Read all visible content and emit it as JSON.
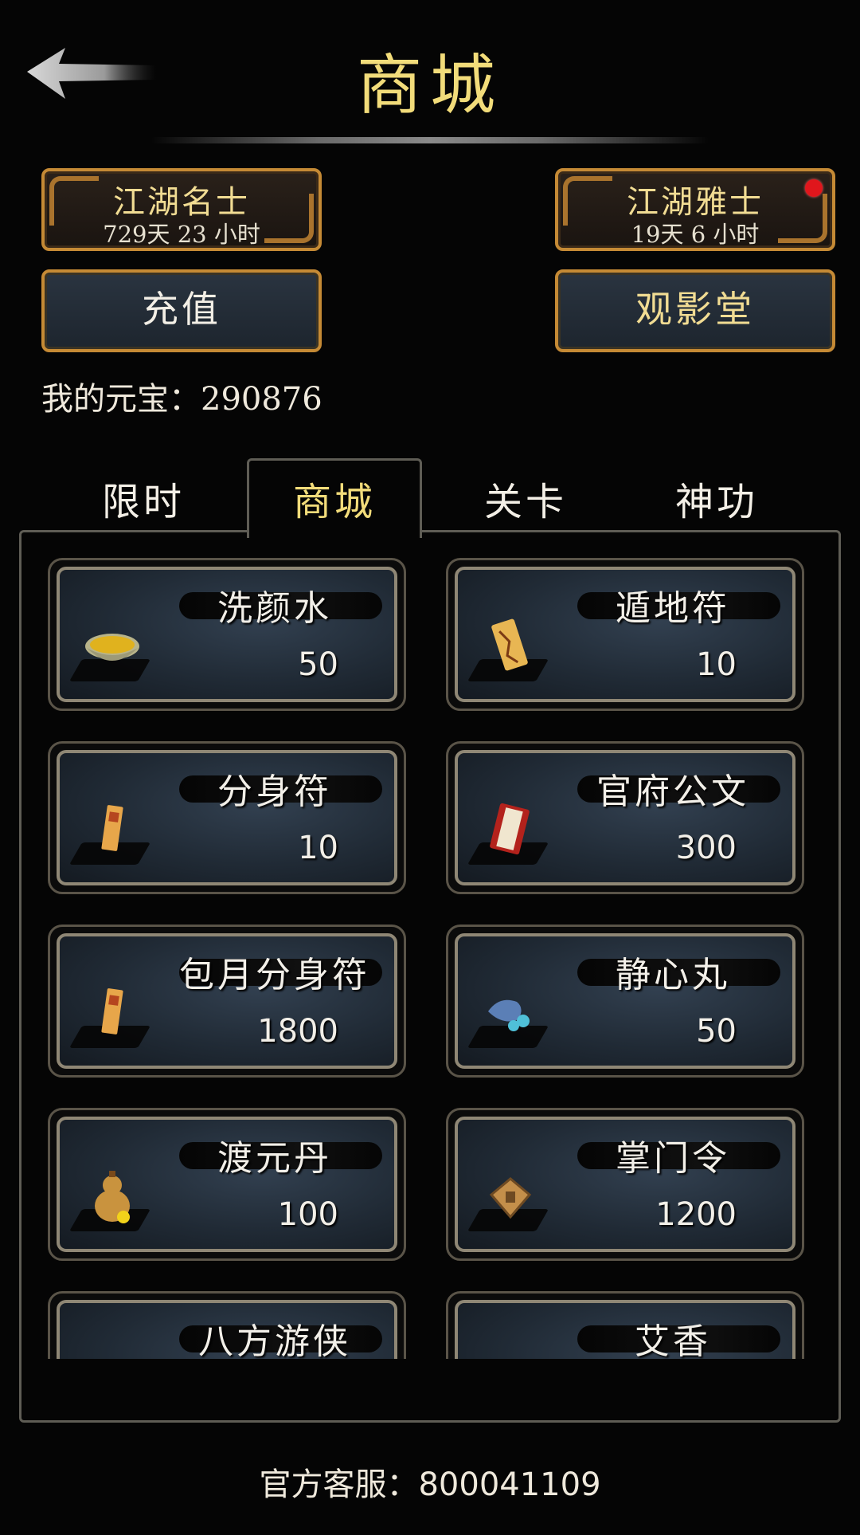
{
  "header": {
    "title": "商城"
  },
  "vip_badges": [
    {
      "name": "江湖名士",
      "time": "729天 23 小时",
      "has_alert": false
    },
    {
      "name": "江湖雅士",
      "time": "19天 6 小时",
      "has_alert": true
    }
  ],
  "actions": {
    "recharge_label": "充值",
    "theater_label": "观影堂"
  },
  "wallet": {
    "label": "我的元宝：",
    "amount": "290876"
  },
  "tabs": [
    {
      "label": "限时",
      "active": false
    },
    {
      "label": "商城",
      "active": true
    },
    {
      "label": "关卡",
      "active": false
    },
    {
      "label": "神功",
      "active": false
    }
  ],
  "shop_items": [
    {
      "name": "洗颜水",
      "price": "50",
      "icon": "tea-bowl-icon"
    },
    {
      "name": "遁地符",
      "price": "10",
      "icon": "talisman-icon"
    },
    {
      "name": "分身符",
      "price": "10",
      "icon": "clone-talisman-icon"
    },
    {
      "name": "官府公文",
      "price": "300",
      "icon": "official-scroll-icon"
    },
    {
      "name": "包月分身符",
      "price": "1800",
      "icon": "clone-talisman-icon"
    },
    {
      "name": "静心丸",
      "price": "50",
      "icon": "pill-pouch-icon"
    },
    {
      "name": "渡元丹",
      "price": "100",
      "icon": "gourd-icon"
    },
    {
      "name": "掌门令",
      "price": "1200",
      "icon": "token-icon"
    },
    {
      "name": "八方游侠",
      "price": "",
      "icon": "wanderer-icon"
    },
    {
      "name": "艾香",
      "price": "",
      "icon": "incense-icon"
    }
  ],
  "footer": {
    "service_label": "官方客服：",
    "service_number": "800041109"
  },
  "colors": {
    "gold_text": "#f2dc7a",
    "frame_orange": "#c58a35",
    "alert_red": "#e0161c"
  }
}
